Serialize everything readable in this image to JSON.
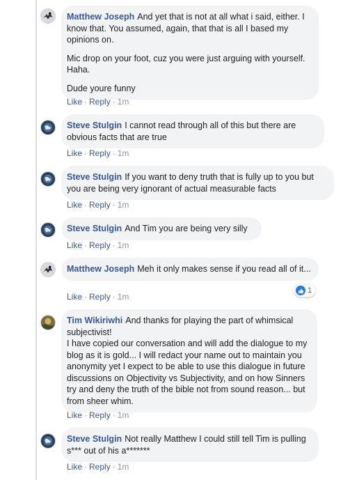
{
  "actions": {
    "like": "Like",
    "reply": "Reply",
    "separator": "·"
  },
  "colors": {
    "link": "#385898",
    "bubble": "#f2f3f5",
    "like_blue": "#2078f4"
  },
  "comments": [
    {
      "author": "Matthew Joseph",
      "avatar": "eagle-avatar",
      "paragraphs": [
        "And yet that is not at all what i said, either. I know that. You assumed, again, that that is all I based my opinions on.",
        "Mic drop on your foot, cuz you were just arguing with yourself. Haha.",
        "Dude youre funny"
      ],
      "time": "1m"
    },
    {
      "author": "Steve Stulgin",
      "avatar": "globe-avatar",
      "paragraphs": [
        "I cannot read through all of this but there are obvious facts that are true"
      ],
      "time": "1m"
    },
    {
      "author": "Steve Stulgin",
      "avatar": "globe-avatar",
      "paragraphs": [
        "If you want to deny truth that is fully up to you but you are being very ignorant of actual measurable facts"
      ],
      "time": "1m"
    },
    {
      "author": "Steve Stulgin",
      "avatar": "globe-avatar",
      "paragraphs": [
        "And Tim you are being very silly"
      ],
      "time": "1m"
    },
    {
      "author": "Matthew Joseph",
      "avatar": "eagle-avatar",
      "paragraphs": [
        "Meh it only makes sense if you read all of it..."
      ],
      "time": "1m",
      "reaction": {
        "icon": "like-icon",
        "count": "1"
      }
    },
    {
      "author": "Tim Wikiriwhi",
      "avatar": "landscape-avatar",
      "paragraphs": [
        "And thanks for playing the part of whimsical subjectivist!\nI have copied our conversation and will add the dialogue to my blog as it is gold... I will redact your name out to maintain you anonymity yet I expect to be able to use this dialogue in future discussions on Objectivity vs Subjectivity, and on how Sinners try and deny the truth of the bible not from sound reason... but from sheer whim."
      ],
      "time": "1m"
    },
    {
      "author": "Steve Stulgin",
      "avatar": "globe-avatar",
      "paragraphs": [
        "Not really Matthew I could still tell Tim is pulling s*** out of his a*******"
      ],
      "time": "1m"
    }
  ]
}
